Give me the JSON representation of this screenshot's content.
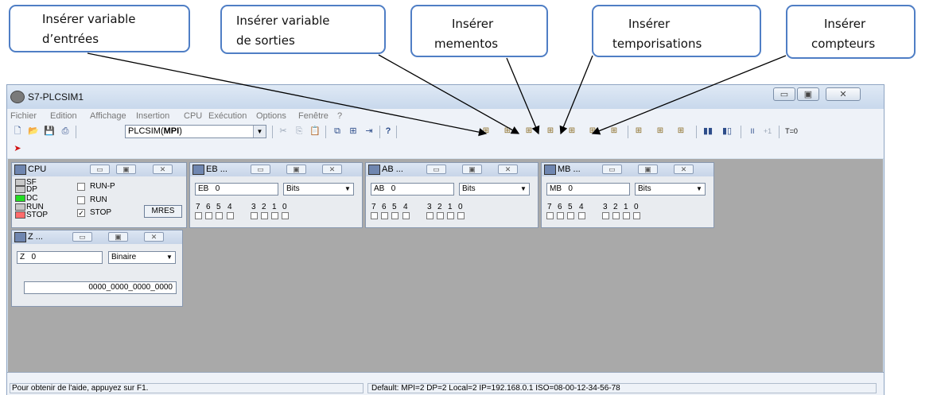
{
  "callouts": [
    {
      "line1": "Insérer variable",
      "line2": "d’entrées"
    },
    {
      "line1": "Insérer variable",
      "line2": "de sorties"
    },
    {
      "line1": "Insérer",
      "line2": "mementos"
    },
    {
      "line1": "Insérer",
      "line2": "temporisations"
    },
    {
      "line1": "Insérer",
      "line2": "compteurs"
    }
  ],
  "window": {
    "title": "S7-PLCSIM1",
    "menu": [
      "Fichier",
      "Edition",
      "Affichage",
      "Insertion",
      "CPU",
      "Exécution",
      "Options",
      "Fenêtre",
      "?"
    ],
    "connection_combo": {
      "prefix": "PLCSIM(",
      "bold": "MPI",
      "suffix": ")"
    },
    "toolbar_right": {
      "pause": "II",
      "step": "+1",
      "reset_timer": "T=0"
    }
  },
  "cpu": {
    "title": "CPU",
    "leds": [
      {
        "label": "SF",
        "color": "#c8c8c8"
      },
      {
        "label": "DP",
        "color": "#c8c8c8"
      },
      {
        "label": "DC",
        "color": "#22dd22"
      },
      {
        "label": "RUN",
        "color": "#c8c8c8"
      },
      {
        "label": "STOP",
        "color": "#ff6b6b"
      }
    ],
    "modes": [
      {
        "label": "RUN-P",
        "checked": ""
      },
      {
        "label": "RUN",
        "checked": ""
      },
      {
        "label": "STOP",
        "checked": "✓"
      }
    ],
    "mres": "MRES"
  },
  "var_windows": [
    {
      "title": "EB ...",
      "area": "EB",
      "address": "0",
      "format": "Bits"
    },
    {
      "title": "AB ...",
      "area": "AB",
      "address": "0",
      "format": "Bits"
    },
    {
      "title": "MB ...",
      "area": "MB",
      "address": "0",
      "format": "Bits"
    }
  ],
  "bit_numbers": [
    "7",
    "6",
    "5",
    "4",
    "3",
    "2",
    "1",
    "0"
  ],
  "counter_window": {
    "title": "Z ...",
    "area": "Z",
    "address": "0",
    "format": "Binaire",
    "value": "0000_0000_0000_0000"
  },
  "status": {
    "help": "Pour obtenir de l'aide, appuyez sur F1.",
    "connection": "Default:  MPI=2 DP=2 Local=2 IP=192.168.0.1 ISO=08-00-12-34-56-78"
  },
  "colors": {
    "callout_border": "#4f7ec5",
    "arrow": "#000000",
    "workspace": "#a9a9a9"
  },
  "icons": [
    "new-icon",
    "open-icon",
    "save-icon",
    "print-icon",
    "cut-icon",
    "copy-icon",
    "paste-icon",
    "help-icon",
    "insert-input-icon",
    "insert-output-icon",
    "insert-memento-icon",
    "insert-timer-icon",
    "insert-counter-icon",
    "pause-icon"
  ]
}
